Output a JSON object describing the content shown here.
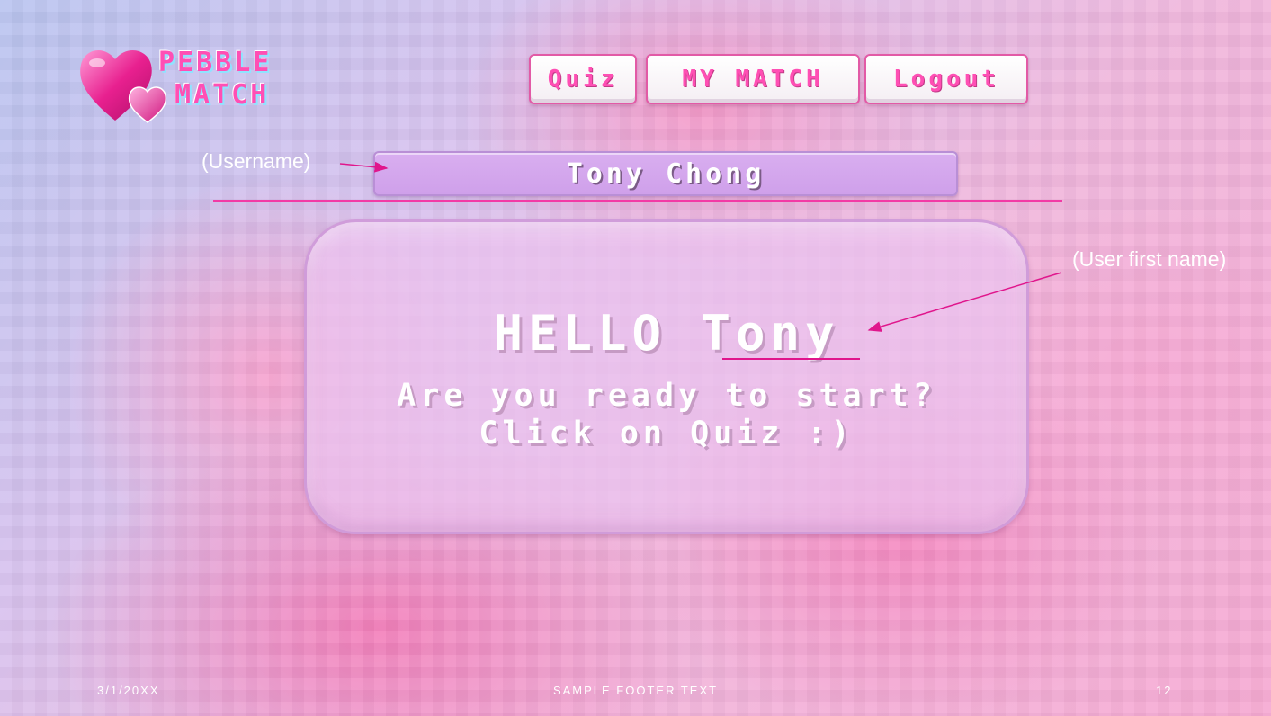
{
  "logo": {
    "line1": "PEBBLE",
    "line2": "MATCH",
    "icon": "hearts-icon"
  },
  "nav": {
    "quiz": "Quiz",
    "my_match": "MY MATCH",
    "logout": "Logout"
  },
  "annotations": {
    "username": "(Username)",
    "first_name": "(User first name)"
  },
  "user": {
    "username": "Tony Chong",
    "greeting": "HELLO",
    "first_name": "Tony"
  },
  "prompt": {
    "line1": "Are you ready to start?",
    "line2": "Click on Quiz :)"
  },
  "footer": {
    "date": "3/1/20XX",
    "text": "SAMPLE FOOTER TEXT",
    "page": "12"
  },
  "colors": {
    "accent_pink": "#ff4fb4",
    "divider": "#f23aa5",
    "username_bar": "#d9aef0"
  }
}
